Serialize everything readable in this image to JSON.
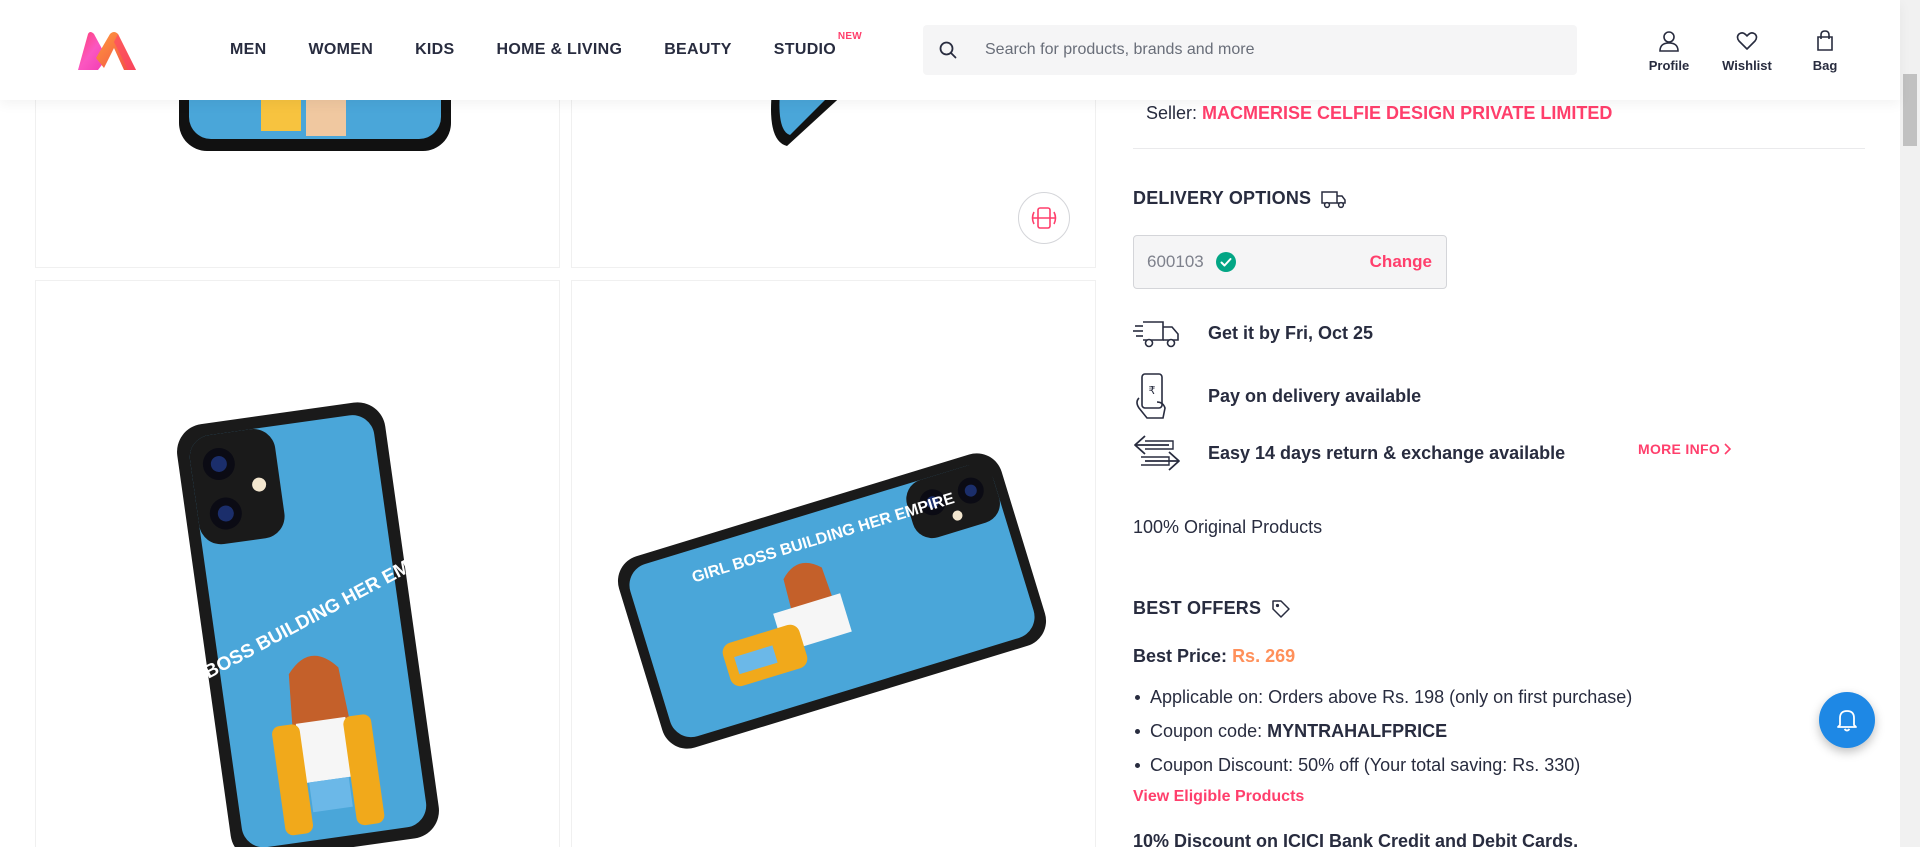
{
  "header": {
    "nav": [
      {
        "label": "MEN"
      },
      {
        "label": "WOMEN"
      },
      {
        "label": "KIDS"
      },
      {
        "label": "HOME & LIVING"
      },
      {
        "label": "BEAUTY"
      },
      {
        "label": "STUDIO",
        "tag": "NEW"
      }
    ],
    "search_placeholder": "Search for products, brands and more",
    "actions": [
      {
        "label": "Profile",
        "icon": "profile-icon"
      },
      {
        "label": "Wishlist",
        "icon": "heart-icon"
      },
      {
        "label": "Bag",
        "icon": "bag-icon"
      }
    ]
  },
  "product": {
    "case_text": "GIRL BOSS BUILDING HER EMPIRE",
    "case_color": "#4aa6d9"
  },
  "seller": {
    "prefix": "Seller:",
    "name": "MACMERISE CELFIE DESIGN PRIVATE LIMITED"
  },
  "delivery": {
    "title": "DELIVERY OPTIONS",
    "pincode": "600103",
    "change_label": "Change",
    "rows": [
      {
        "icon": "fast-truck-icon",
        "text": "Get it by Fri, Oct 25"
      },
      {
        "icon": "cash-on-delivery-icon",
        "text": "Pay on delivery available"
      },
      {
        "icon": "exchange-icon",
        "text": "Easy 14 days return & exchange available"
      }
    ],
    "more_info": "MORE INFO",
    "original": "100% Original Products"
  },
  "offers": {
    "title": "BEST OFFERS",
    "best_price_label": "Best Price:",
    "best_price_value": "Rs. 269",
    "items": [
      {
        "text": "Applicable on: Orders above Rs. 198 (only on first purchase)"
      },
      {
        "prefix": "Coupon code: ",
        "bold": "MYNTRAHALFPRICE"
      },
      {
        "text": "Coupon Discount: 50% off (Your total saving: Rs. 330)"
      }
    ],
    "eligible_link": "View Eligible Products",
    "next_offer": "10% Discount on ICICI Bank Credit and Debit Cards."
  },
  "colors": {
    "accent": "#ff3f6c",
    "text": "#282c3f",
    "price": "#ff905a",
    "success": "#03a685",
    "bell": "#1e88e5"
  }
}
